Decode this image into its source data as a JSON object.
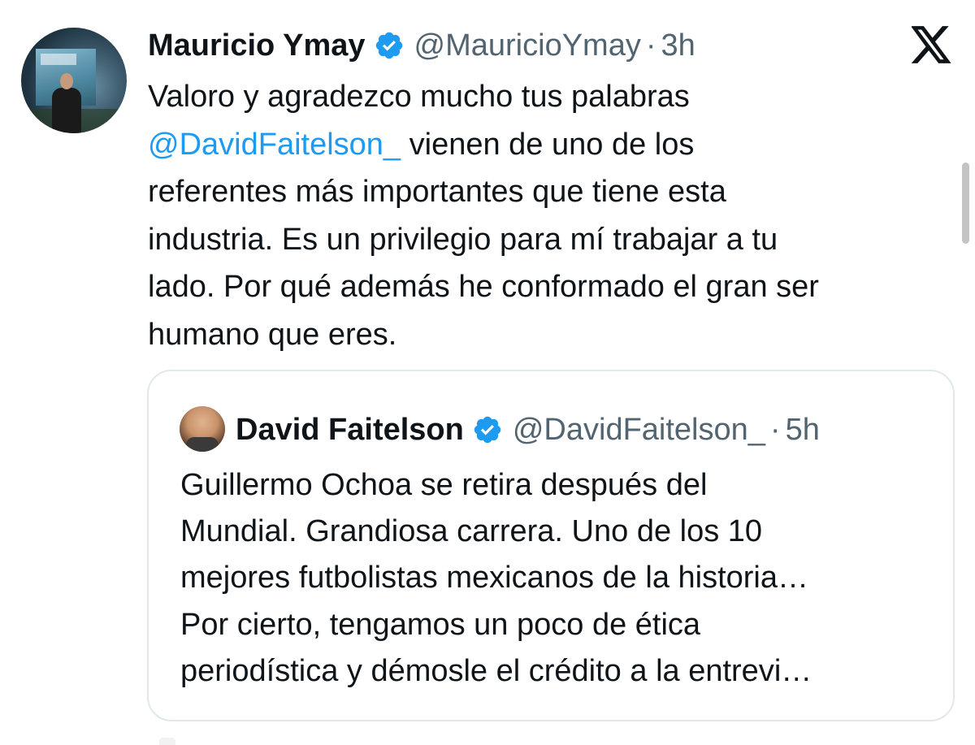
{
  "tweet": {
    "author_name": "Mauricio Ymay",
    "author_handle": "@MauricioYmay",
    "separator": "·",
    "time": "3h",
    "text_lines": [
      [
        {
          "text": "Valoro y agradezco mucho tus palabras",
          "mention": false
        }
      ],
      [
        {
          "text": "@DavidFaitelson_",
          "mention": true
        },
        {
          "text": " vienen de uno de los",
          "mention": false
        }
      ],
      [
        {
          "text": "referentes más importantes que tiene esta",
          "mention": false
        }
      ],
      [
        {
          "text": "industria. Es un privilegio para mí trabajar a tu",
          "mention": false
        }
      ],
      [
        {
          "text": "lado. Por qué además he conformado el gran ser",
          "mention": false
        }
      ],
      [
        {
          "text": "humano que eres.",
          "mention": false
        }
      ]
    ]
  },
  "quoted_tweet": {
    "author_name": "David Faitelson",
    "author_handle": "@DavidFaitelson_",
    "separator": "·",
    "time": "5h",
    "text_lines": [
      "Guillermo Ochoa se retira después del",
      "Mundial. Grandiosa carrera. Uno de los 10",
      "mejores futbolistas mexicanos de la historia…",
      "Por cierto, tengamos un poco de ética",
      "periodística y démosle el crédito a la entrevi…"
    ]
  },
  "icons": {
    "verified": "verified-badge-icon",
    "close": "x-logo-icon"
  },
  "colors": {
    "text": "#0f1419",
    "secondary": "#536471",
    "mention": "#1d9bf0",
    "verified": "#1d9bf0",
    "border": "#e1e8ed"
  }
}
